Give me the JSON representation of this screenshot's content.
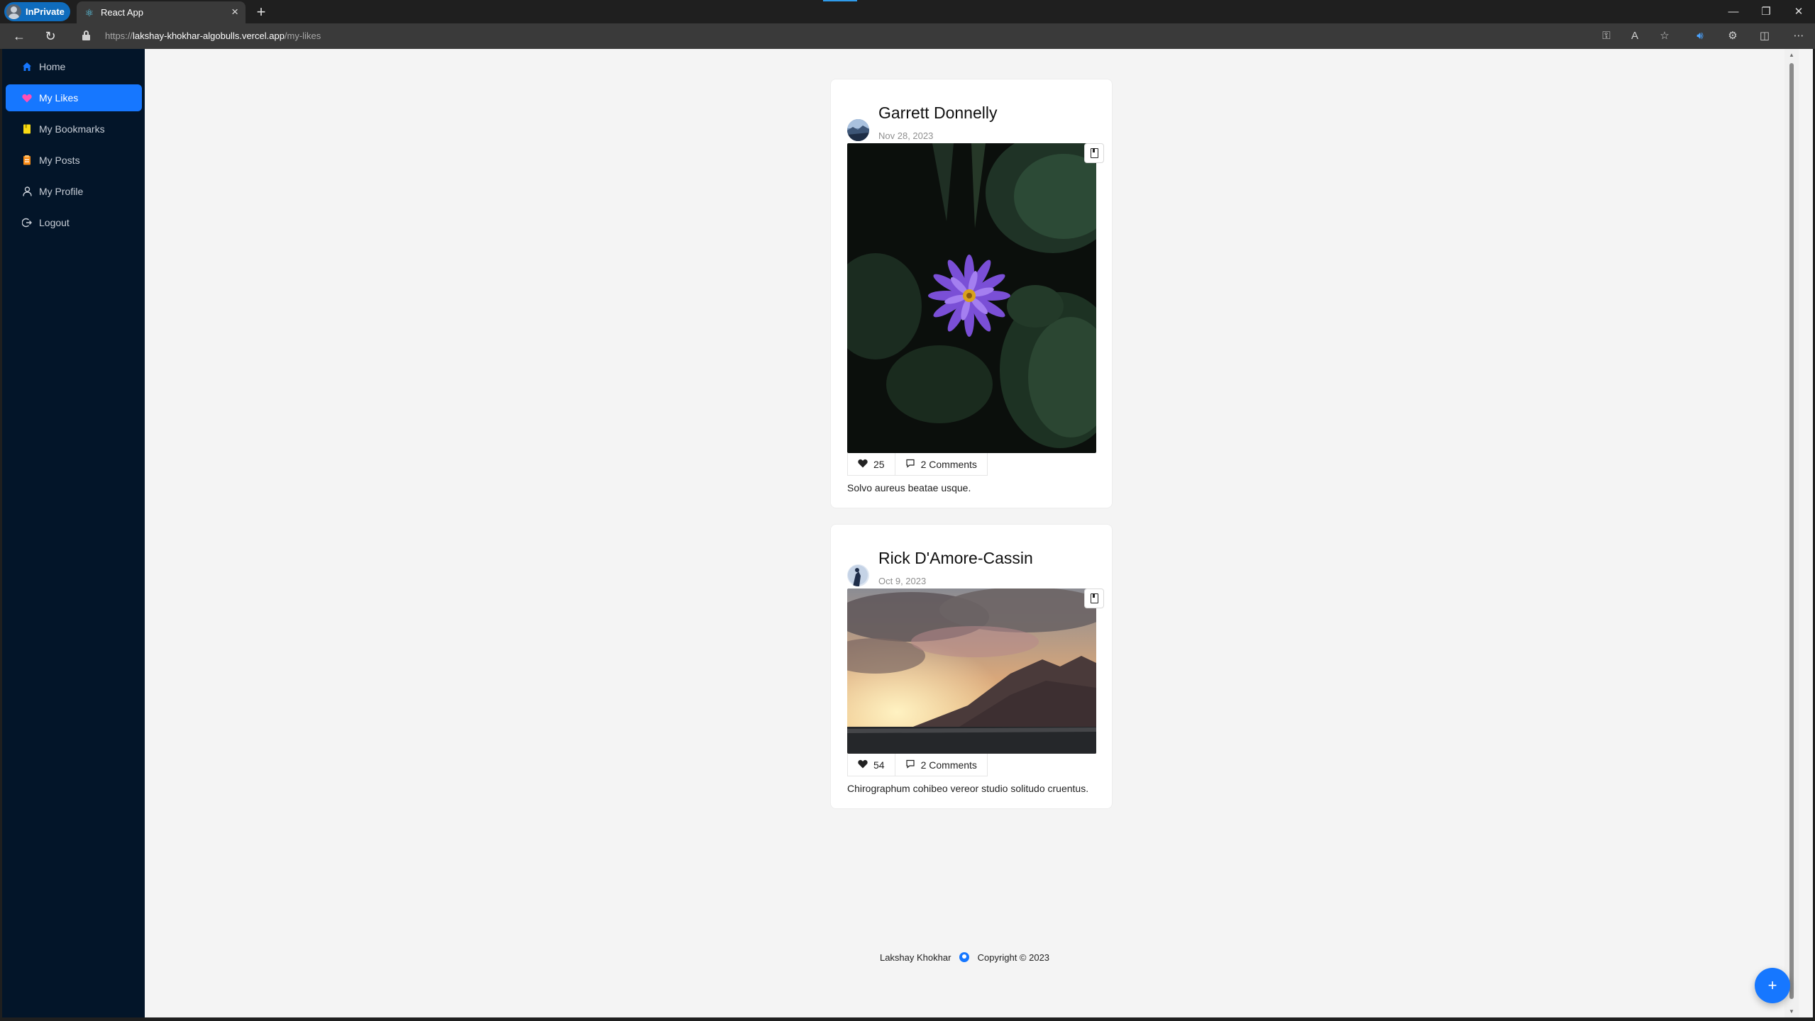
{
  "browser": {
    "profile_label": "InPrivate",
    "tab_title": "React App",
    "url_scheme": "https://",
    "url_host": "lakshay-khokhar-algobulls.vercel.app",
    "url_path": "/my-likes"
  },
  "sidebar": {
    "items": [
      {
        "label": "Home",
        "icon": "home-icon",
        "color": "#1677ff"
      },
      {
        "label": "My Likes",
        "icon": "heart-icon",
        "color": "#ff4fb6",
        "active": true
      },
      {
        "label": "My Bookmarks",
        "icon": "bookmark-icon",
        "color": "#fadb14"
      },
      {
        "label": "My Posts",
        "icon": "posts-icon",
        "color": "#fa8c16"
      },
      {
        "label": "My Profile",
        "icon": "user-icon",
        "color": "#c7cdd6"
      },
      {
        "label": "Logout",
        "icon": "logout-icon",
        "color": "#c7cdd6"
      }
    ]
  },
  "posts": [
    {
      "author": "Garrett Donnelly",
      "date": "Nov 28, 2023",
      "likes": "25",
      "comments": "2 Comments",
      "caption": "Solvo aureus beatae usque."
    },
    {
      "author": "Rick D'Amore-Cassin",
      "date": "Oct 9, 2023",
      "likes": "54",
      "comments": "2 Comments",
      "caption": "Chirographum cohibeo vereor studio solitudo cruentus."
    }
  ],
  "footer": {
    "name": "Lakshay Khokhar",
    "copyright": "Copyright © 2023"
  },
  "fab_label": "+",
  "colors": {
    "accent": "#1677ff",
    "sidebar_bg": "#031529",
    "page_bg": "#f4f4f4"
  }
}
